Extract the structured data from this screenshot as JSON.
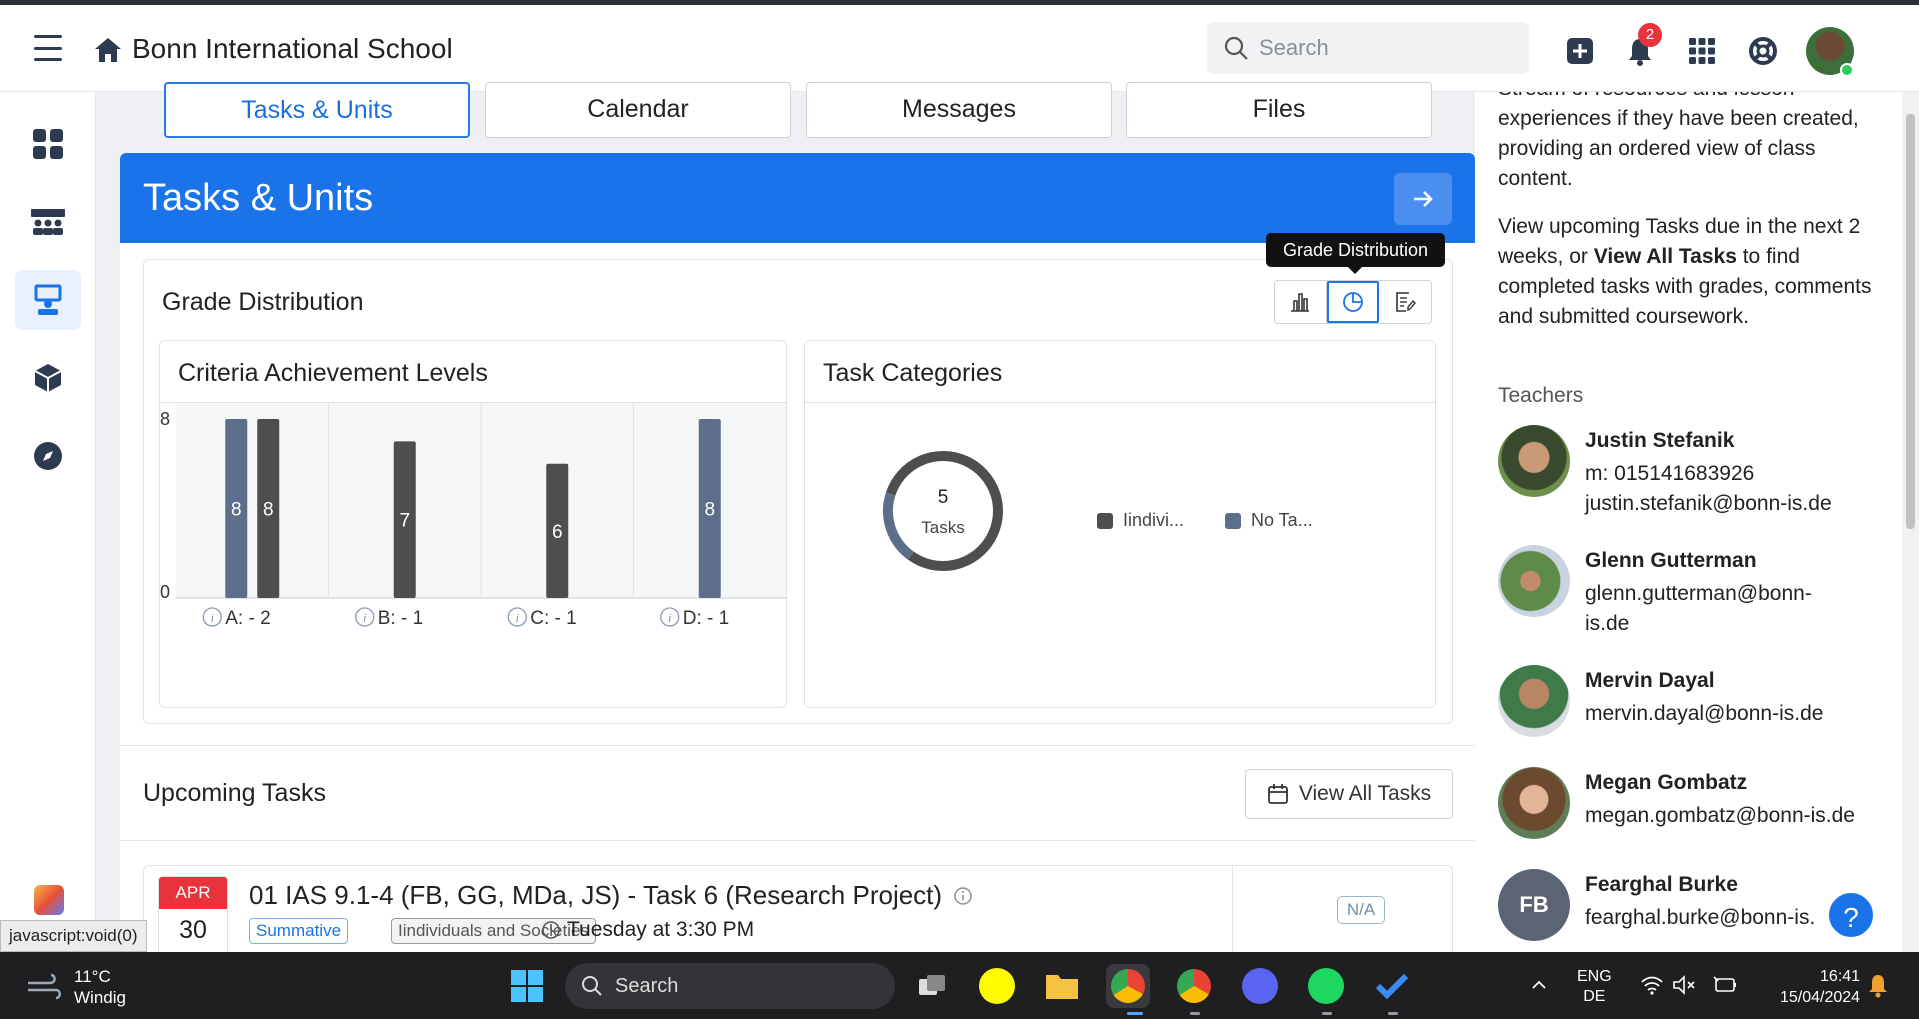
{
  "header": {
    "school_name": "Bonn International School",
    "search_placeholder": "Search",
    "notification_count": "2"
  },
  "tabs": [
    {
      "label": "Tasks & Units",
      "active": true
    },
    {
      "label": "Calendar",
      "active": false
    },
    {
      "label": "Messages",
      "active": false
    },
    {
      "label": "Files",
      "active": false
    }
  ],
  "section": {
    "title": "Tasks & Units"
  },
  "grade_distribution": {
    "title": "Grade Distribution",
    "tooltip": "Grade Distribution",
    "criteria_title": "Criteria Achievement Levels",
    "categories_title": "Task Categories"
  },
  "chart_data": [
    {
      "type": "bar",
      "title": "Criteria Achievement Levels",
      "categories": [
        "A: - 2",
        "B: - 1",
        "C: - 1",
        "D: - 1"
      ],
      "ylim": [
        0,
        8
      ],
      "y_ticks": [
        "0",
        "8"
      ],
      "bars": [
        {
          "category": "A: - 2",
          "value": 8,
          "color": "#5c6e8a"
        },
        {
          "category": "A: - 2",
          "value": 8,
          "color": "#4e4e4e"
        },
        {
          "category": "B: - 1",
          "value": 7,
          "color": "#4e4e4e"
        },
        {
          "category": "C: - 1",
          "value": 6,
          "color": "#4e4e4e"
        },
        {
          "category": "D: - 1",
          "value": 8,
          "color": "#5c6e8a"
        }
      ]
    },
    {
      "type": "pie",
      "title": "Task Categories",
      "center_value": "5",
      "center_label": "Tasks",
      "slices": [
        {
          "name": "Iindivi...",
          "value": 4,
          "color": "#4e4e4e"
        },
        {
          "name": "No Ta...",
          "value": 1,
          "color": "#5c6e8a"
        }
      ]
    }
  ],
  "upcoming": {
    "title": "Upcoming Tasks",
    "view_all_label": "View All Tasks",
    "tasks": [
      {
        "month": "APR",
        "day": "30",
        "title": "01 IAS 9.1-4 (FB, GG, MDa, JS) - Task 6 (Research Project)",
        "tag_type": "Summative",
        "tag_subject": "Iindividuals and Societies",
        "due": "Tuesday at 3:30 PM",
        "grade": "N/A"
      }
    ]
  },
  "right_panel": {
    "para1": "Stream of resources and lesson experiences if they have been created, providing an ordered view of class content.",
    "para2_pre": "View upcoming Tasks due in the next 2 weeks, or ",
    "para2_bold": "View All Tasks",
    "para2_post": " to find completed tasks with grades, comments and submitted coursework.",
    "teachers_label": "Teachers",
    "teachers": [
      {
        "name": "Justin Stefanik",
        "phone": "m: 015141683926",
        "email": "justin.stefanik@bonn-is.de"
      },
      {
        "name": "Glenn Gutterman",
        "email1": "glenn.gutterman@bonn-",
        "email2": "is.de"
      },
      {
        "name": "Mervin Dayal",
        "email": "mervin.dayal@bonn-is.de"
      },
      {
        "name": "Megan Gombatz",
        "email": "megan.gombatz@bonn-is.de"
      },
      {
        "name": "Fearghal Burke",
        "initials": "FB",
        "email": "fearghal.burke@bonn-is."
      }
    ]
  },
  "status_url": "javascript:void(0)",
  "taskbar": {
    "temp": "11°C",
    "weather": "Windig",
    "search": "Search",
    "lang1": "ENG",
    "lang2": "DE",
    "time": "16:41",
    "date": "15/04/2024"
  },
  "colors": {
    "accent": "#1a73e8",
    "bar_dark": "#4e4e4e",
    "bar_blue": "#5c6e8a",
    "date_red": "#e8323c"
  }
}
